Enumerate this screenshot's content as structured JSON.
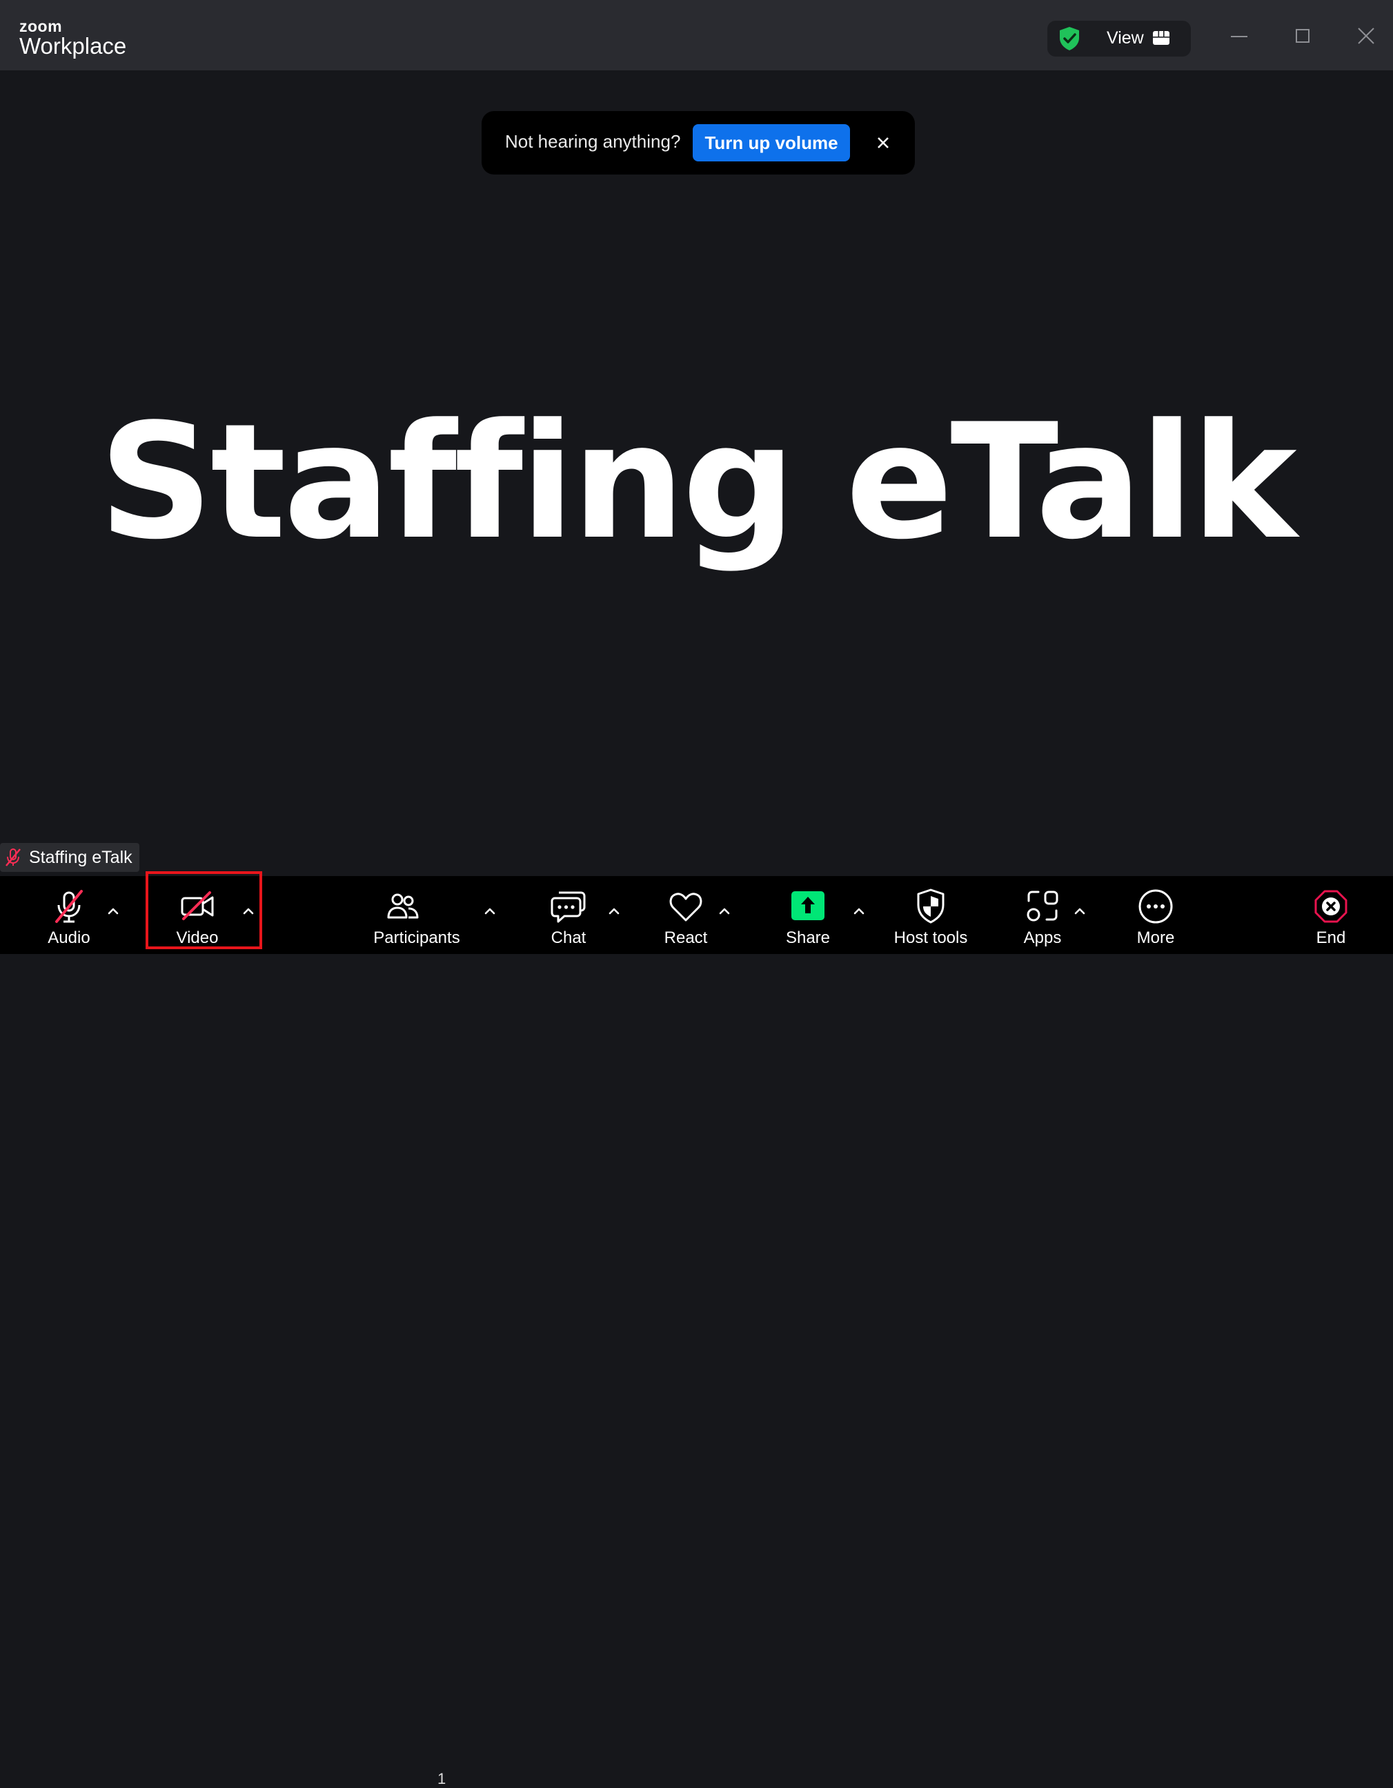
{
  "app": {
    "logo_top": "zoom",
    "logo_bottom": "Workplace"
  },
  "titlebar": {
    "view_label": "View"
  },
  "toast": {
    "message": "Not hearing anything?",
    "button_label": "Turn up volume"
  },
  "stage": {
    "shared_title": "Staffing eTalk",
    "participant_name": "Staffing eTalk"
  },
  "toolbar": {
    "audio": "Audio",
    "video": "Video",
    "participants": "Participants",
    "participants_count": "1",
    "chat": "Chat",
    "react": "React",
    "share": "Share",
    "host_tools": "Host tools",
    "apps": "Apps",
    "more": "More",
    "end": "End"
  },
  "colors": {
    "accent_blue": "#0e71eb",
    "share_green": "#00e676",
    "end_red": "#e8134e",
    "muted_red": "#ff2d55",
    "highlight_red": "#e8151b"
  }
}
